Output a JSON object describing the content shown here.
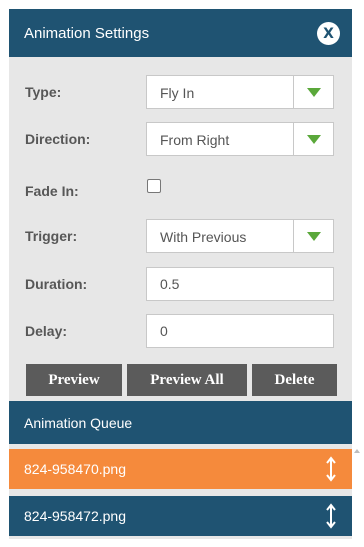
{
  "header": {
    "title": "Animation Settings",
    "close_label": "X"
  },
  "fields": {
    "type": {
      "label": "Type:",
      "value": "Fly In"
    },
    "direction": {
      "label": "Direction:",
      "value": "From Right"
    },
    "fade_in": {
      "label": "Fade In:",
      "checked": false
    },
    "trigger": {
      "label": "Trigger:",
      "value": "With Previous"
    },
    "duration": {
      "label": "Duration:",
      "value": "0.5"
    },
    "delay": {
      "label": "Delay:",
      "value": "0"
    }
  },
  "buttons": {
    "preview": "Preview",
    "preview_all": "Preview All",
    "delete": "Delete"
  },
  "queue": {
    "title": "Animation Queue",
    "items": [
      {
        "label": "824-958470.png",
        "selected": true
      },
      {
        "label": "824-958472.png",
        "selected": false
      }
    ]
  },
  "colors": {
    "header_bg": "#1f5372",
    "panel_bg": "#e7e7e7",
    "button_bg": "#5b5b5b",
    "selected_item_bg": "#f58a3c",
    "accent_arrow": "#5aa83a"
  },
  "icons": {
    "close": "close-icon",
    "dropdown": "chevron-down-icon",
    "drag": "drag-handle-icon"
  }
}
